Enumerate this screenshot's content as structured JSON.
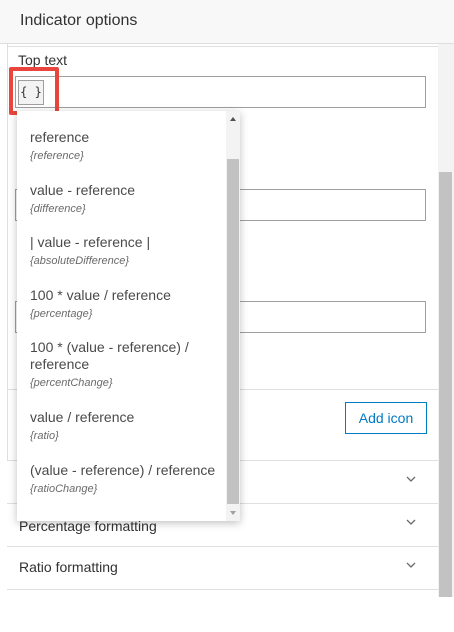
{
  "panel": {
    "title": "Indicator options",
    "top_text_label": "Top text",
    "expression_button_label": "{ }",
    "add_icon_label": "Add icon"
  },
  "dropdown_items": [
    {
      "label": "reference",
      "code": "{reference}"
    },
    {
      "label": "value - reference",
      "code": "{difference}"
    },
    {
      "label": "| value - reference |",
      "code": "{absoluteDifference}"
    },
    {
      "label": "100 * value / reference",
      "code": "{percentage}"
    },
    {
      "label": "100 * (value - reference) / reference",
      "code": "{percentChange}"
    },
    {
      "label": "value / reference",
      "code": "{ratio}"
    },
    {
      "label": "(value - reference) / reference",
      "code": "{ratioChange}"
    }
  ],
  "collapsibles": [
    {
      "label": ""
    },
    {
      "label": "Percentage formatting"
    },
    {
      "label": "Ratio formatting"
    },
    {
      "label": ""
    }
  ],
  "colors": {
    "accent": "#007ac2",
    "highlight": "#e8453c"
  },
  "icons": {
    "chevron": "chevron-down-icon",
    "scroll_up": "arrow-up-icon",
    "scroll_down": "arrow-down-icon"
  }
}
